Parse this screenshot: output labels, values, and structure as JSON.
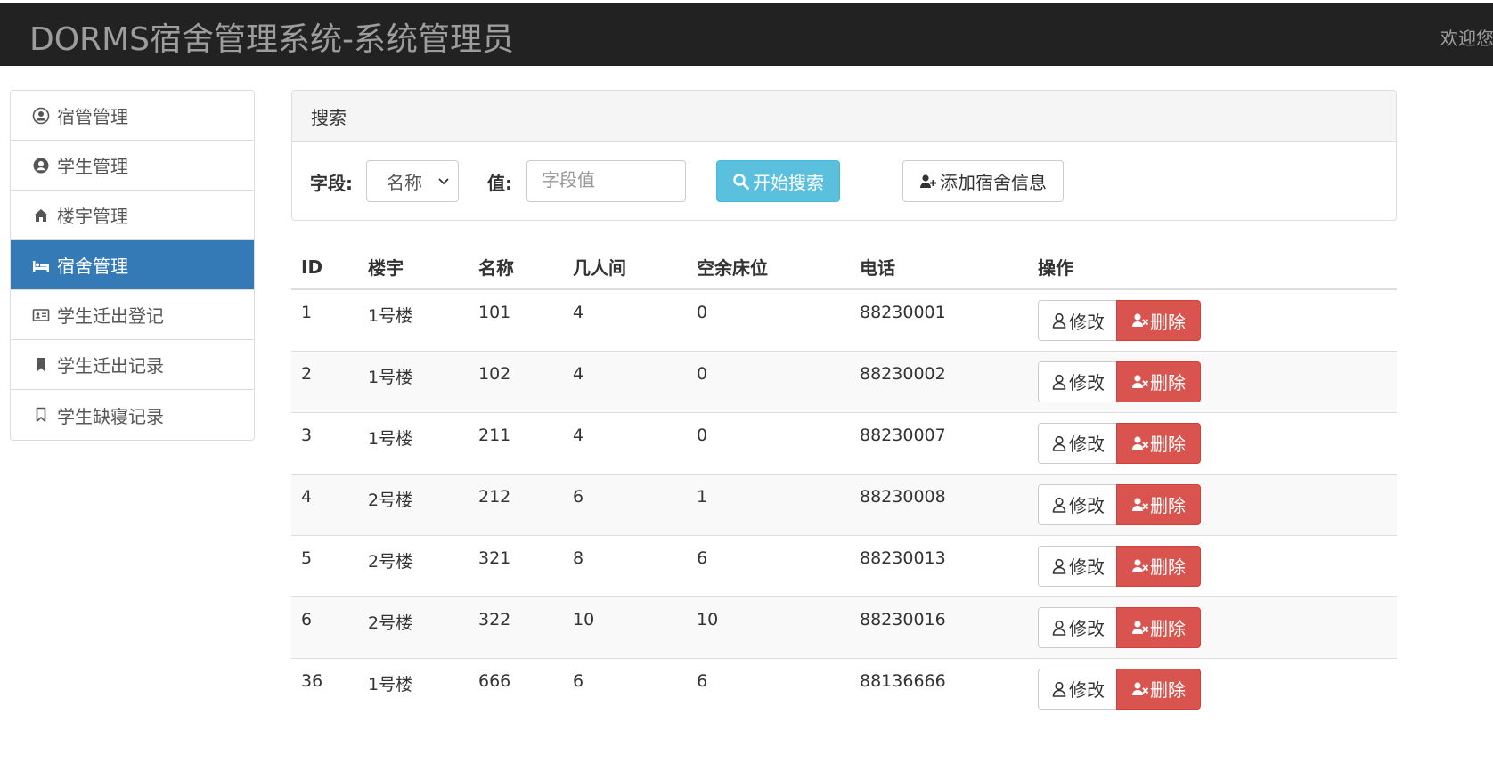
{
  "navbar": {
    "brand": "DORMS宿舍管理系统-系统管理员",
    "welcome": "欢迎您"
  },
  "sidebar": {
    "items": [
      {
        "label": "宿管管理",
        "icon": "user-circle-icon",
        "active": false
      },
      {
        "label": "学生管理",
        "icon": "user-circle-alt-icon",
        "active": false
      },
      {
        "label": "楼宇管理",
        "icon": "home-icon",
        "active": false
      },
      {
        "label": "宿舍管理",
        "icon": "bed-icon",
        "active": true
      },
      {
        "label": "学生迁出登记",
        "icon": "id-card-icon",
        "active": false
      },
      {
        "label": "学生迁出记录",
        "icon": "bookmark-filled-icon",
        "active": false
      },
      {
        "label": "学生缺寝记录",
        "icon": "bookmark-outline-icon",
        "active": false
      }
    ]
  },
  "search": {
    "title": "搜索",
    "field_label": "字段:",
    "field_value": "名称",
    "value_label": "值:",
    "value_placeholder": "字段值",
    "search_button": "开始搜索",
    "add_button": "添加宿舍信息"
  },
  "table": {
    "headers": [
      "ID",
      "楼宇",
      "名称",
      "几人间",
      "空余床位",
      "电话",
      "操作"
    ],
    "rows": [
      {
        "id": "1",
        "building": "1号楼",
        "name": "101",
        "capacity": "4",
        "vacant": "0",
        "phone": "88230001"
      },
      {
        "id": "2",
        "building": "1号楼",
        "name": "102",
        "capacity": "4",
        "vacant": "0",
        "phone": "88230002"
      },
      {
        "id": "3",
        "building": "1号楼",
        "name": "211",
        "capacity": "4",
        "vacant": "0",
        "phone": "88230007"
      },
      {
        "id": "4",
        "building": "2号楼",
        "name": "212",
        "capacity": "6",
        "vacant": "1",
        "phone": "88230008"
      },
      {
        "id": "5",
        "building": "2号楼",
        "name": "321",
        "capacity": "8",
        "vacant": "6",
        "phone": "88230013"
      },
      {
        "id": "6",
        "building": "2号楼",
        "name": "322",
        "capacity": "10",
        "vacant": "10",
        "phone": "88230016"
      },
      {
        "id": "36",
        "building": "1号楼",
        "name": "666",
        "capacity": "6",
        "vacant": "6",
        "phone": "88136666"
      }
    ],
    "edit_label": "修改",
    "delete_label": "删除"
  },
  "colors": {
    "navbar": "#222222",
    "active": "#337ab7",
    "info": "#5bc0de",
    "danger": "#d9534f"
  }
}
